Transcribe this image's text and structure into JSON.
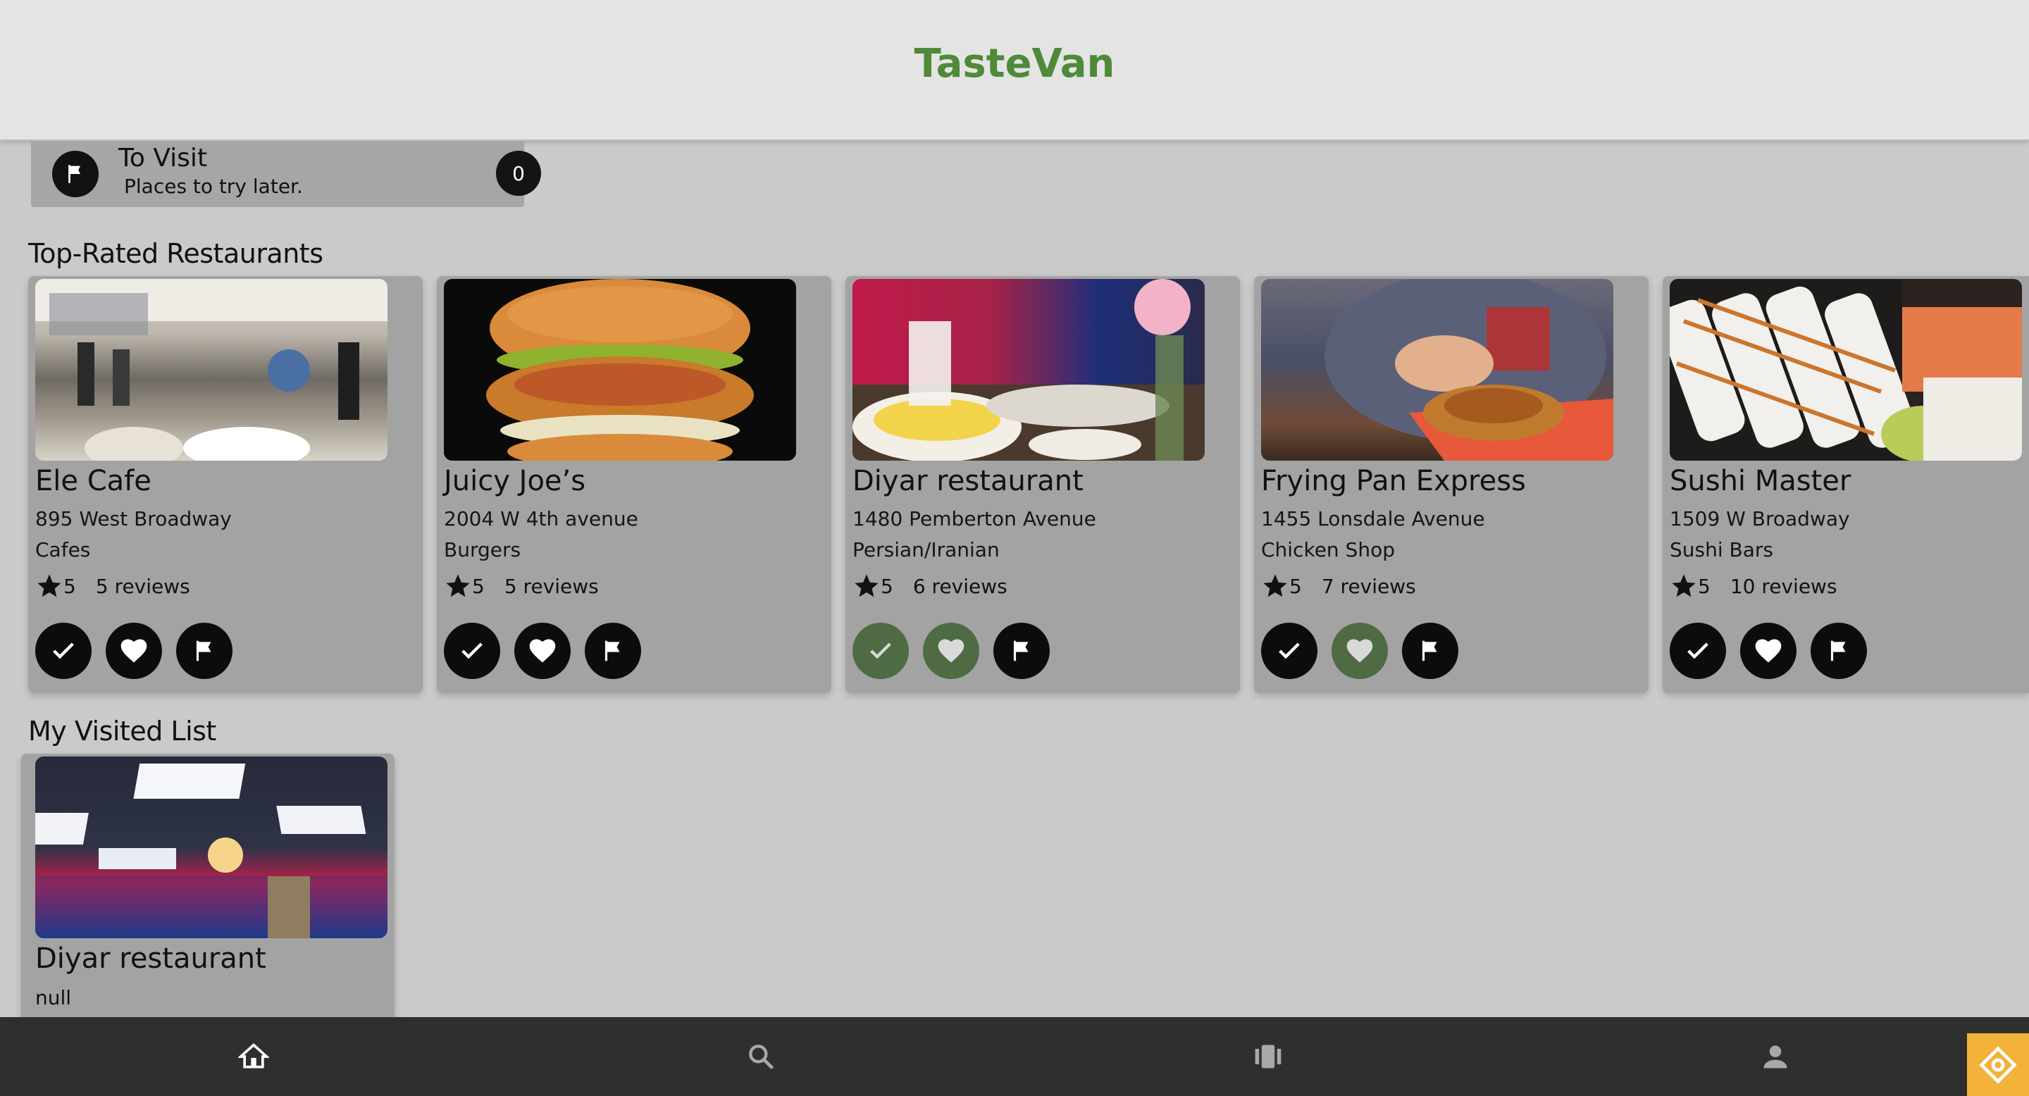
{
  "app": {
    "title": "TasteVan"
  },
  "to_visit": {
    "title": "To Visit",
    "subtitle": "Places to try later.",
    "count": "0"
  },
  "sections": {
    "top_rated": "Top-Rated Restaurants",
    "visited": "My Visited List"
  },
  "restaurants": [
    {
      "name": "Ele Cafe",
      "address": "895 West Broadway",
      "category": "Cafes",
      "rating": "5",
      "reviews": "5 reviews",
      "visited": false,
      "favorite": false,
      "to_visit": false
    },
    {
      "name": "Juicy Joe’s",
      "address": "2004 W 4th avenue",
      "category": "Burgers",
      "rating": "5",
      "reviews": "5 reviews",
      "visited": false,
      "favorite": false,
      "to_visit": false
    },
    {
      "name": "Diyar restaurant",
      "address": "1480 Pemberton Avenue",
      "category": "Persian/Iranian",
      "rating": "5",
      "reviews": "6 reviews",
      "visited": true,
      "favorite": true,
      "to_visit": false
    },
    {
      "name": "Frying Pan Express",
      "address": "1455 Lonsdale Avenue",
      "category": "Chicken Shop",
      "rating": "5",
      "reviews": "7 reviews",
      "visited": false,
      "favorite": true,
      "to_visit": false
    },
    {
      "name": "Sushi Master",
      "address": "1509 W Broadway",
      "category": "Sushi Bars",
      "rating": "5",
      "reviews": "10 reviews",
      "visited": false,
      "favorite": false,
      "to_visit": false
    }
  ],
  "visited_list": [
    {
      "name": "Diyar restaurant",
      "subtitle": "null"
    }
  ],
  "nav": [
    "home-icon",
    "search-icon",
    "cards-icon",
    "profile-icon"
  ],
  "colors": {
    "brand": "#4e8a37",
    "active_action": "#4e6b44",
    "nav_bg": "#2f2f2f",
    "corner_badge": "#f3b23a"
  }
}
